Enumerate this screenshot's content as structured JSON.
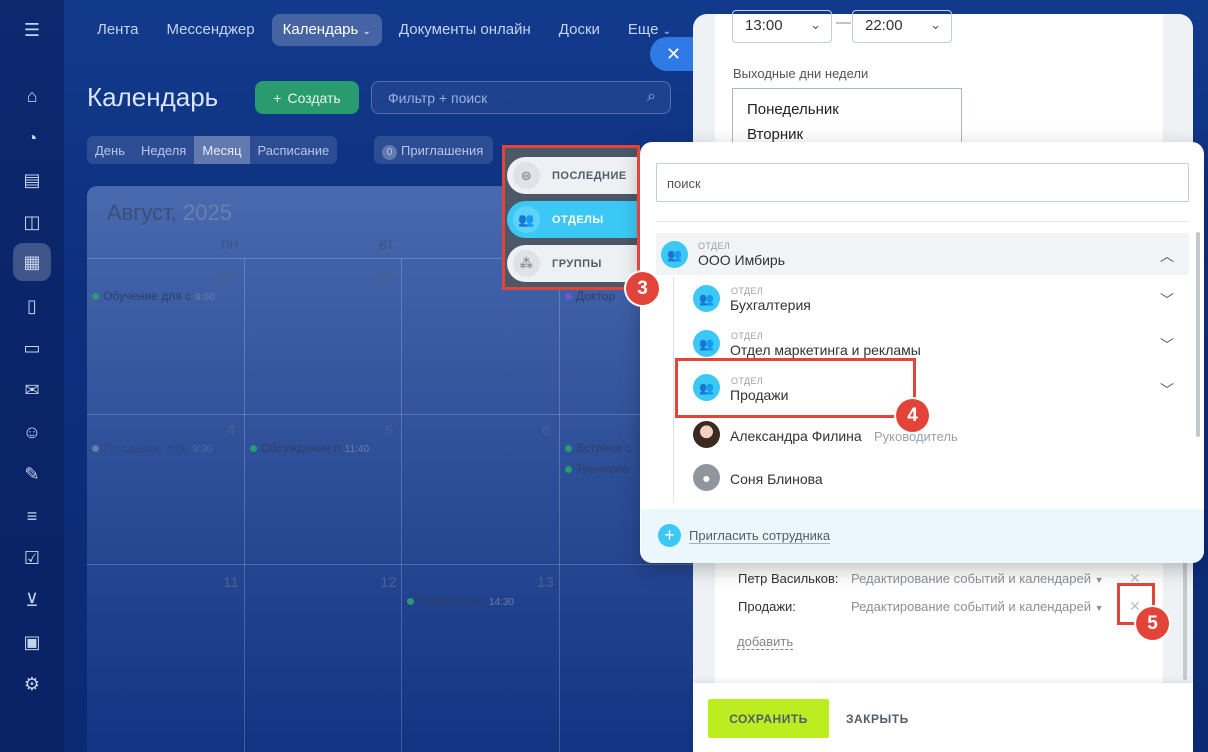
{
  "top_menu": {
    "items": [
      "Лента",
      "Мессенджер",
      "Календарь",
      "Документы онлайн",
      "Доски",
      "Еще"
    ]
  },
  "page": {
    "title": "Календарь",
    "create_label": "Создать",
    "filter_placeholder": "Фильтр + поиск"
  },
  "view_tabs": [
    "День",
    "Неделя",
    "Месяц",
    "Расписание"
  ],
  "invites": {
    "count": "0",
    "label": "Приглашения"
  },
  "calendar": {
    "month": "Август,",
    "year": "2025",
    "days": [
      "ПН",
      "ВТ"
    ],
    "cells": [
      "28",
      "29",
      "4",
      "5",
      "6",
      "11",
      "12",
      "13"
    ],
    "events": [
      {
        "title": "Обучение для с",
        "time": "8:00"
      },
      {
        "title": "Доктор",
        "time": ""
      },
      {
        "title": "По сделке: Нов",
        "time": "9:30"
      },
      {
        "title": "Обсуждение п",
        "time": "11:40"
      },
      {
        "title": "Встреча с",
        "time": ""
      },
      {
        "title": "Трениров",
        "time": ""
      },
      {
        "title": "Тимбилдинг",
        "time": "14:30"
      }
    ]
  },
  "settings": {
    "time_from": "13:00",
    "time_to": "22:00",
    "dash": "—",
    "weekend_label": "Выходные дни недели",
    "weekdays": [
      "Понедельник",
      "Вторник"
    ],
    "access": [
      {
        "name": "Петр Васильков:",
        "right": "Редактирование событий и календарей"
      },
      {
        "name": "Продажи:",
        "right": "Редактирование событий и календарей"
      }
    ],
    "add_label": "добавить",
    "save_label": "СОХРАНИТЬ",
    "close_label": "ЗАКРЫТЬ"
  },
  "selector": {
    "tabs": [
      "ПОСЛЕДНИЕ",
      "ОТДЕЛЫ",
      "ГРУППЫ"
    ],
    "search_placeholder": "поиск",
    "kind_label": "ОТДЕЛ",
    "root": "ООО Имбирь",
    "departments": [
      "Бухгалтерия",
      "Отдел маркетинга и рекламы",
      "Продажи"
    ],
    "people": [
      {
        "name": "Александра Филина",
        "role": "Руководитель"
      },
      {
        "name": "Соня Блинова",
        "role": ""
      }
    ],
    "invite_label": "Пригласить сотрудника"
  },
  "callouts": [
    "3",
    "4",
    "5"
  ],
  "colors": {
    "accent": "#3bc8f5",
    "save": "#bbed21",
    "highlight": "#e3443a"
  }
}
